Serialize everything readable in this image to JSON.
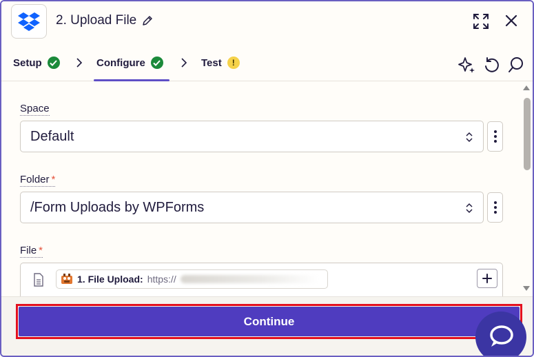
{
  "header": {
    "app_icon": "dropbox-icon",
    "title": "2. Upload File",
    "edit_icon": "pencil-icon",
    "expand_icon": "expand-icon",
    "close_icon": "close-icon"
  },
  "tabs": [
    {
      "label": "Setup",
      "status": "complete"
    },
    {
      "label": "Configure",
      "status": "complete",
      "active": true
    },
    {
      "label": "Test",
      "status": "warning",
      "badge": "!"
    }
  ],
  "toolbar": {
    "icons": [
      "sparkle-icon",
      "undo-icon",
      "search-icon"
    ]
  },
  "fields": {
    "space": {
      "label": "Space",
      "value": "Default",
      "required": false
    },
    "folder": {
      "label": "Folder",
      "value": "/Form Uploads by WPForms",
      "required": true,
      "required_mark": "*"
    },
    "file": {
      "label": "File",
      "required": true,
      "required_mark": "*",
      "pill_label": "1. File Upload:",
      "pill_value": "https://",
      "pill_icon": "wpforms-icon"
    }
  },
  "footer": {
    "continue_label": "Continue"
  },
  "colors": {
    "accent": "#4f3cbf",
    "success": "#1b8a3a",
    "warning": "#f5d24a",
    "highlight": "#e3101f",
    "required": "#e5533d"
  }
}
